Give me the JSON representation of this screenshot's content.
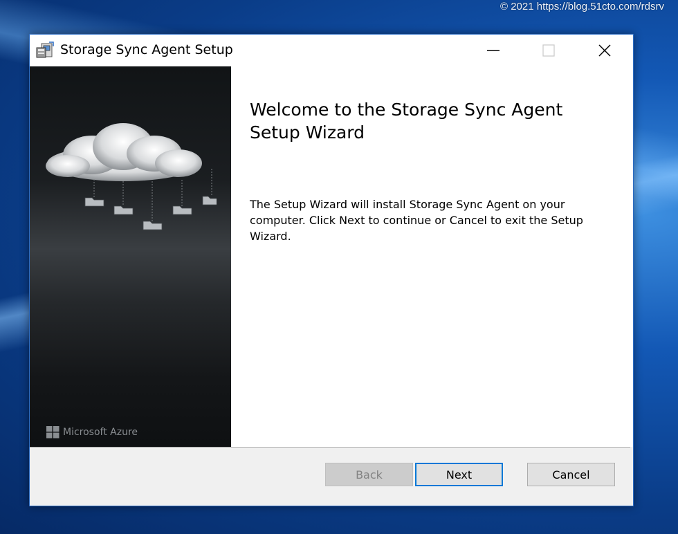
{
  "watermark": "© 2021 https://blog.51cto.com/rdsrv",
  "window": {
    "title": "Storage Sync Agent Setup",
    "icon": "installer-icon",
    "controls": [
      "minimize-icon",
      "maximize-icon",
      "close-icon"
    ]
  },
  "side_panel": {
    "art": "cloud-folders-illustration",
    "logo_text": "Microsoft Azure"
  },
  "main": {
    "title": "Welcome to the Storage Sync Agent Setup Wizard",
    "body": "The Setup Wizard will install Storage Sync Agent on your computer. Click Next to continue or Cancel to exit the Setup Wizard."
  },
  "buttons": {
    "back": "Back",
    "next": "Next",
    "cancel": "Cancel"
  },
  "colors": {
    "accent": "#0078d7",
    "side_panel_dark": "#111416"
  }
}
